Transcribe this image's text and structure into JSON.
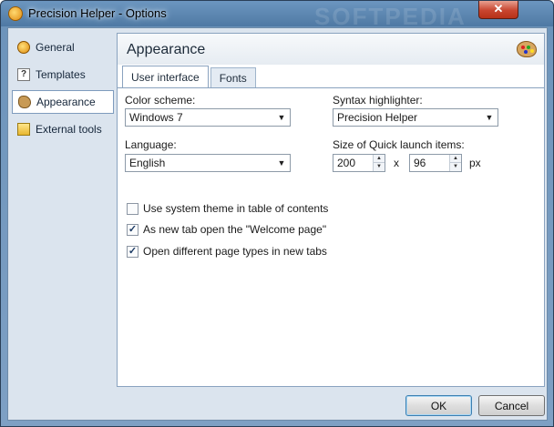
{
  "window": {
    "title": "Precision Helper - Options",
    "watermark": "SOFTPEDIA",
    "close_label": "✕"
  },
  "sidebar": {
    "items": [
      {
        "label": "General",
        "icon": "general-icon",
        "active": false
      },
      {
        "label": "Templates",
        "icon": "templates-icon",
        "active": false
      },
      {
        "label": "Appearance",
        "icon": "appearance-icon",
        "active": true
      },
      {
        "label": "External tools",
        "icon": "external-tools-icon",
        "active": false
      }
    ]
  },
  "main": {
    "title": "Appearance",
    "tabs": [
      {
        "label": "User interface",
        "selected": true
      },
      {
        "label": "Fonts",
        "selected": false
      }
    ],
    "color_scheme": {
      "label": "Color scheme:",
      "value": "Windows 7"
    },
    "syntax_highlighter": {
      "label": "Syntax highlighter:",
      "value": "Precision Helper"
    },
    "language": {
      "label": "Language:",
      "value": "English"
    },
    "quick_launch": {
      "label": "Size of Quick launch items:",
      "width": "200",
      "separator": "x",
      "height": "96",
      "unit": "px"
    },
    "checkboxes": [
      {
        "label": "Use system theme in table of contents",
        "checked": false
      },
      {
        "label": "As new tab open the \"Welcome page\"",
        "checked": true
      },
      {
        "label": "Open different page types in new tabs",
        "checked": true
      }
    ]
  },
  "buttons": {
    "ok": "OK",
    "cancel": "Cancel"
  },
  "icons": {
    "combo_arrow": "▼",
    "spin_up": "▲",
    "spin_down": "▼",
    "check_mark": "✓",
    "templates_glyph": "?"
  }
}
